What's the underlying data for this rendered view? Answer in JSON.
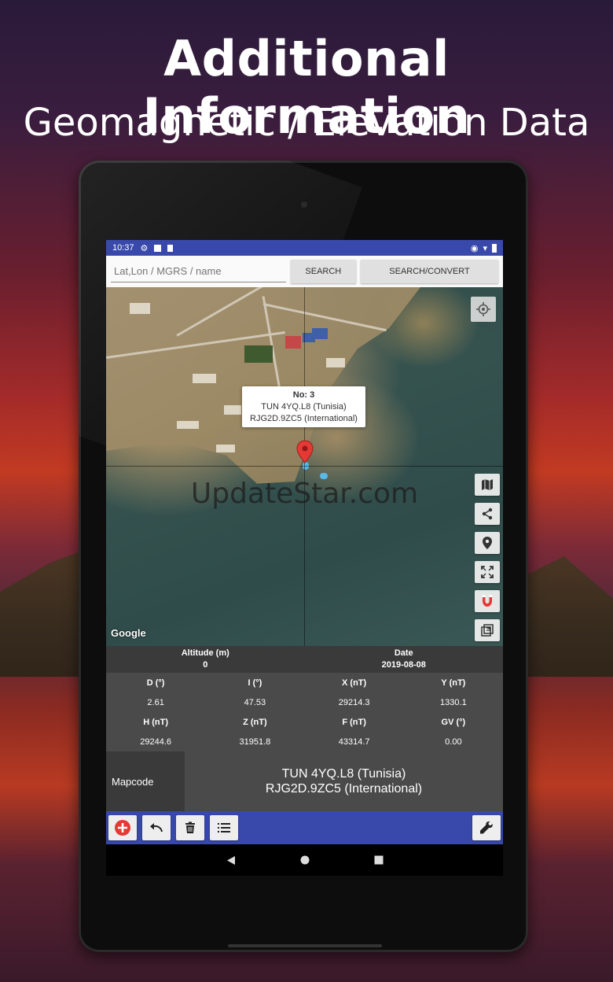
{
  "promo": {
    "headline": "Additional Information",
    "subline": "Geomagnetic / Elevation Data"
  },
  "statusbar": {
    "time": "10:37"
  },
  "search": {
    "placeholder": "Lat,Lon / MGRS / name",
    "search_label": "SEARCH",
    "convert_label": "SEARCH/CONVERT"
  },
  "map": {
    "popup": {
      "title": "No: 3",
      "line1": "TUN 4YQ.L8 (Tunisia)",
      "line2": "RJG2D.9ZC5 (International)"
    },
    "watermark": "UpdateStar.com",
    "attribution": "Google",
    "side_buttons": [
      "map-layers-icon",
      "share-icon",
      "marker-icon",
      "fullscreen-icon",
      "magnet-icon",
      "copy-icon"
    ]
  },
  "info": {
    "altitude_label": "Altitude (m)",
    "altitude_value": "0",
    "date_label": "Date",
    "date_value": "2019-08-08",
    "headers1": [
      "D (°)",
      "I (°)",
      "X (nT)",
      "Y (nT)"
    ],
    "values1": [
      "2.61",
      "47.53",
      "29214.3",
      "1330.1"
    ],
    "headers2": [
      "H (nT)",
      "Z (nT)",
      "F (nT)",
      "GV (°)"
    ],
    "values2": [
      "29244.6",
      "31951.8",
      "43314.7",
      "0.00"
    ]
  },
  "mapcode": {
    "label": "Mapcode",
    "line1": "TUN 4YQ.L8 (Tunisia)",
    "line2": "RJG2D.9ZC5 (International)"
  },
  "toolbar": {
    "accent": "#3949ab",
    "add_color": "#e53935",
    "magnet_color": "#e53935"
  }
}
